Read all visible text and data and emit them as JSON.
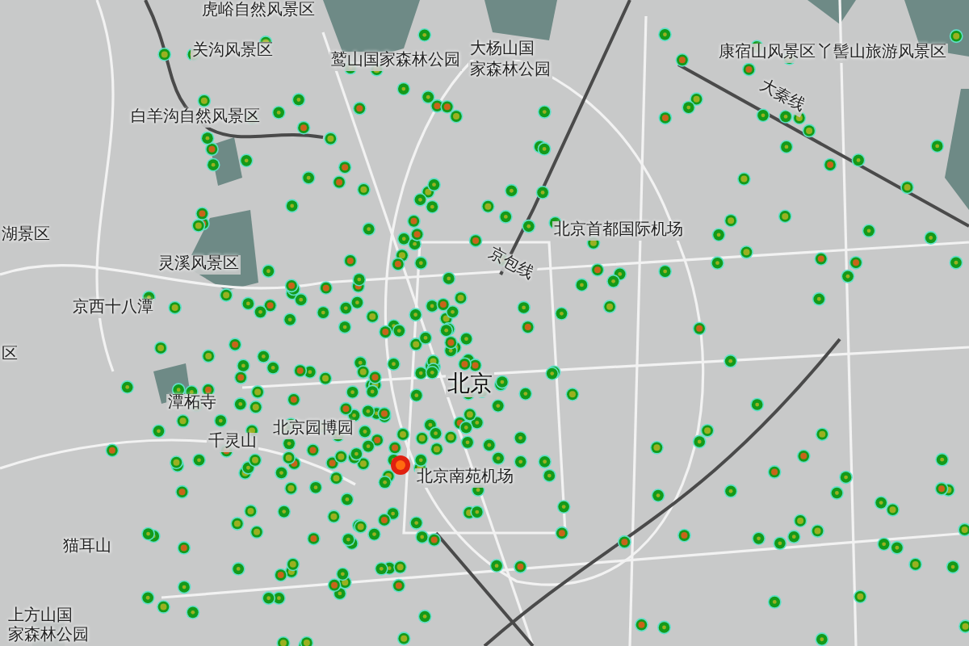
{
  "map": {
    "labels": [
      {
        "text": "虎峪自然风景区",
        "kind": "place"
      },
      {
        "text": "关沟风景区",
        "kind": "place"
      },
      {
        "text": "鹫山国家森林公园",
        "kind": "place"
      },
      {
        "text": "大杨山国",
        "kind": "place"
      },
      {
        "text": "家森林公园",
        "kind": "place"
      },
      {
        "text": "康宿山风景区",
        "kind": "place"
      },
      {
        "text": "丫髻山旅游风景区",
        "kind": "place"
      },
      {
        "text": "白羊沟自然风景区",
        "kind": "place"
      },
      {
        "text": "大秦线",
        "kind": "rail"
      },
      {
        "text": "湖景区",
        "kind": "place"
      },
      {
        "text": "北京首都国际机场",
        "kind": "place"
      },
      {
        "text": "灵溪风景区",
        "kind": "place"
      },
      {
        "text": "京包线",
        "kind": "rail"
      },
      {
        "text": "京西十八潭",
        "kind": "place"
      },
      {
        "text": "区",
        "kind": "place"
      },
      {
        "text": "北京",
        "kind": "city"
      },
      {
        "text": "潭柘寺",
        "kind": "place"
      },
      {
        "text": "北京园博园",
        "kind": "place"
      },
      {
        "text": "千灵山",
        "kind": "place"
      },
      {
        "text": "北京南苑机场",
        "kind": "place"
      },
      {
        "text": "猫耳山",
        "kind": "place"
      },
      {
        "text": "上方山国",
        "kind": "place"
      },
      {
        "text": "家森林公园",
        "kind": "place"
      }
    ]
  }
}
